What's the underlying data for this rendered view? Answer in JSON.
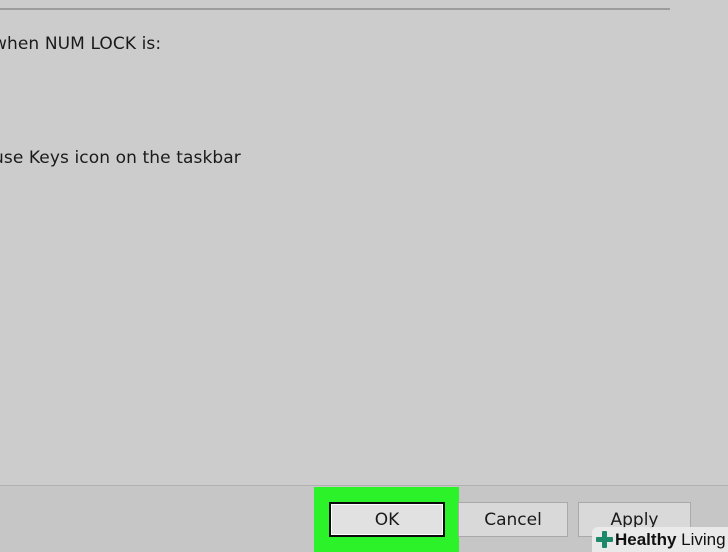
{
  "dialog": {
    "numlock_label": "when NUM LOCK is:",
    "taskbar_label": "use Keys icon on the taskbar"
  },
  "footer": {
    "ok_label": "OK",
    "cancel_label": "Cancel",
    "apply_label": "Apply",
    "highlight_color": "#2cf229"
  },
  "watermark": {
    "brand_bold": "Healthy",
    "brand_rest": " Living",
    "icon": "plus-cross-icon"
  }
}
